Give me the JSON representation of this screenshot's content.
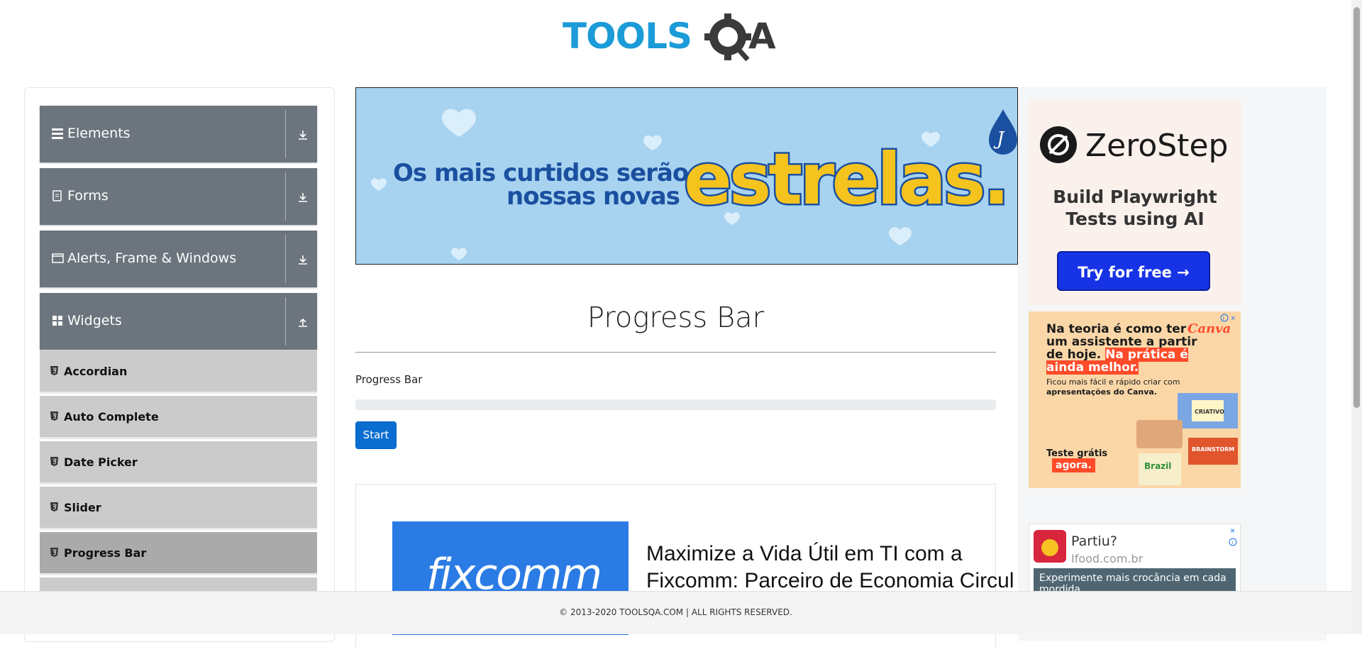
{
  "header": {
    "logo_text_left": "TOOLS",
    "logo_text_right": "A"
  },
  "sidebar": {
    "groups": [
      {
        "label": "Elements",
        "icon": "hamburger-icon",
        "arrow": "download-icon"
      },
      {
        "label": "Forms",
        "icon": "document-icon",
        "arrow": "download-icon"
      },
      {
        "label": "Alerts, Frame & Windows",
        "icon": "window-icon",
        "arrow": "download-icon"
      },
      {
        "label": "Widgets",
        "icon": "grid-icon",
        "arrow": "upload-icon"
      }
    ],
    "items": [
      {
        "label": "Accordian",
        "active": false
      },
      {
        "label": "Auto Complete",
        "active": false
      },
      {
        "label": "Date Picker",
        "active": false
      },
      {
        "label": "Slider",
        "active": false
      },
      {
        "label": "Progress Bar",
        "active": true
      }
    ]
  },
  "ads": {
    "top": {
      "line1": "Os mais curtidos serão",
      "line2": "nossas novas",
      "big": "estrelas.",
      "brand_letter": "J"
    },
    "zerostep": {
      "name": "ZeroStep",
      "tagline": "Build Playwright Tests using AI",
      "button": "Try for free →"
    },
    "canva": {
      "headline_plain": "Na teoria é como ter um assistente a partir de hoje.",
      "headline_highlight": "Na prática é ainda melhor.",
      "brand": "Canva",
      "sub_plain": "Ficou mais fácil e rápido criar com ",
      "sub_bold": "apresentações do Canva.",
      "cta_line1": "Teste grátis",
      "cta_line2": "agora.",
      "tag1": "CRIATIVO",
      "tag2": "BRAINSTORM",
      "tag3": "Brazil"
    },
    "ifood": {
      "title": "Partiu?",
      "url": "Ifood.com.br",
      "desc": "Experimente mais crocância em cada mordida"
    }
  },
  "main": {
    "title": "Progress Bar",
    "progress_label": "Progress Bar",
    "progress_value": 0,
    "start_button": "Start"
  },
  "article": {
    "image_text": "fixcomm",
    "title": "Maximize a Vida Útil em TI com a Fixcomm: Parceiro de Economia Circular"
  },
  "footer": {
    "text": "© 2013-2020 TOOLSQA.COM | ALL RIGHTS RESERVED."
  },
  "colors": {
    "sidebar_group": "#6c757d",
    "sidebar_item": "#cbcbcb",
    "sidebar_active": "#aaaaaa",
    "primary": "#007bff"
  }
}
